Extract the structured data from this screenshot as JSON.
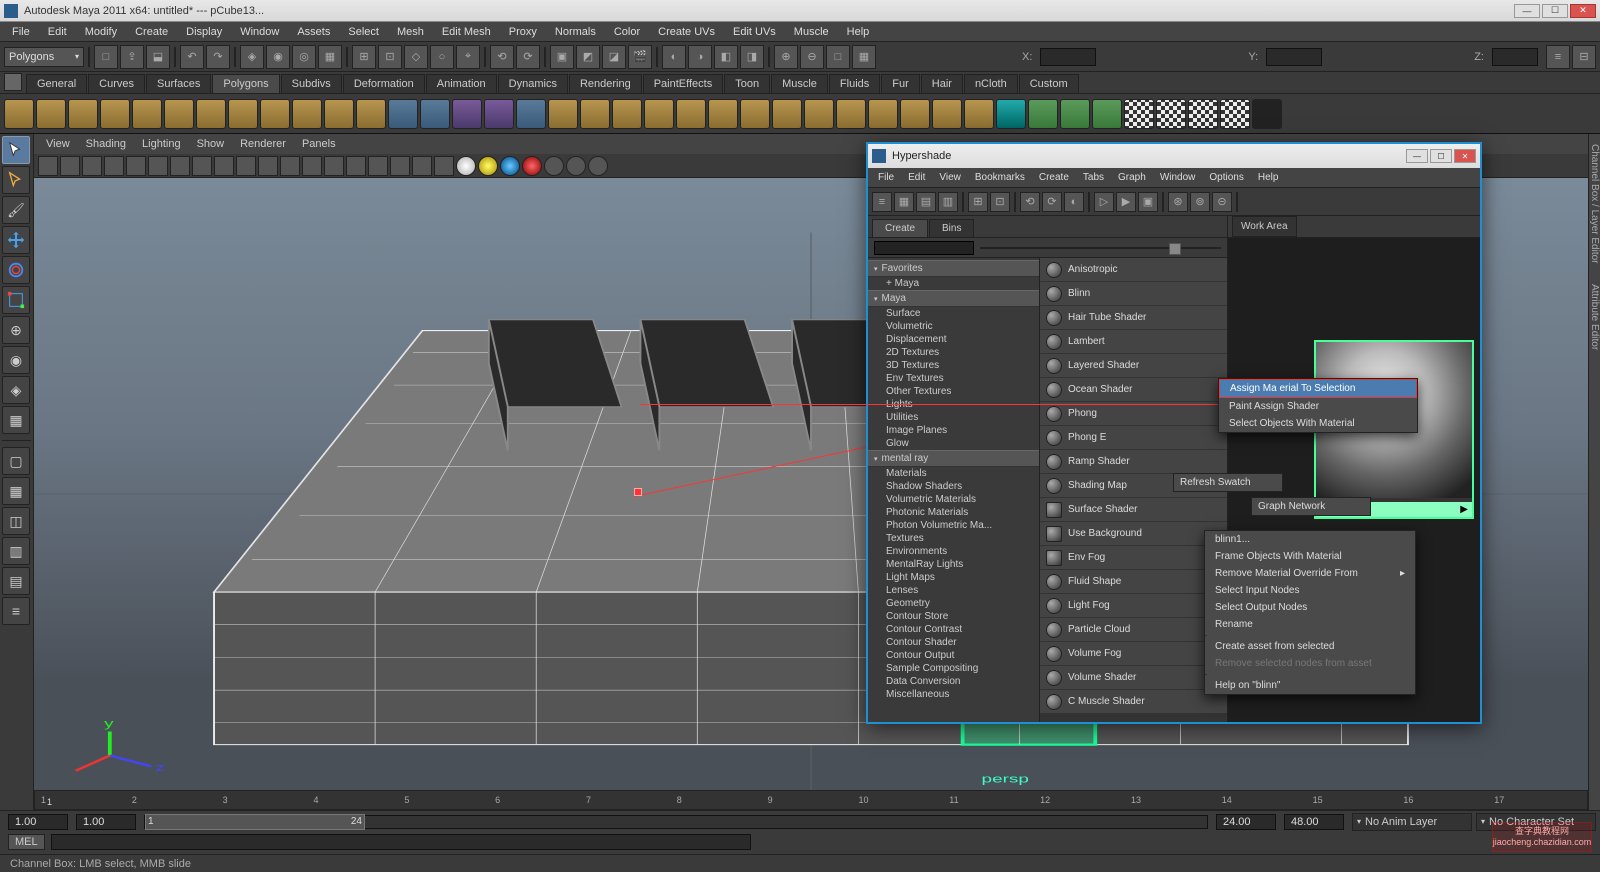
{
  "window": {
    "title": "Autodesk Maya 2011 x64: untitled*  ---   pCube13..."
  },
  "main_menu": [
    "File",
    "Edit",
    "Modify",
    "Create",
    "Display",
    "Window",
    "Assets",
    "Select",
    "Mesh",
    "Edit Mesh",
    "Proxy",
    "Normals",
    "Color",
    "Create UVs",
    "Edit UVs",
    "Muscle",
    "Help"
  ],
  "preset": "Polygons",
  "coords": {
    "x_label": "X:",
    "y_label": "Y:",
    "z_label": "Z:"
  },
  "shelf_tabs": [
    "General",
    "Curves",
    "Surfaces",
    "Polygons",
    "Subdivs",
    "Deformation",
    "Animation",
    "Dynamics",
    "Rendering",
    "PaintEffects",
    "Toon",
    "Muscle",
    "Fluids",
    "Fur",
    "Hair",
    "nCloth",
    "Custom"
  ],
  "shelf_active": "Polygons",
  "view_menu": [
    "View",
    "Shading",
    "Lighting",
    "Show",
    "Renderer",
    "Panels"
  ],
  "viewport_label": "persp",
  "right_sidebar": [
    "Channel Box / Layer Editor",
    "Attribute Editor"
  ],
  "timeline": {
    "ticks": [
      "1",
      "2",
      "3",
      "4",
      "5",
      "6",
      "7",
      "8",
      "9",
      "10",
      "11",
      "12",
      "13",
      "14",
      "15",
      "16",
      "17"
    ],
    "start": "1",
    "current": "1"
  },
  "range": {
    "in": "1.00",
    "in2": "1.00",
    "out": "24.00",
    "out2": "48.00",
    "noanim": "No Anim Layer",
    "nochar": "No Character Set"
  },
  "cmd": {
    "tag": "MEL"
  },
  "status": "Channel Box: LMB select, MMB slide",
  "hypershade": {
    "title": "Hypershade",
    "menu": [
      "File",
      "Edit",
      "View",
      "Bookmarks",
      "Create",
      "Tabs",
      "Graph",
      "Window",
      "Options",
      "Help"
    ],
    "tabs": [
      "Create",
      "Bins"
    ],
    "active_tab": "Create",
    "work_label": "Work Area",
    "tree": [
      {
        "type": "cat",
        "label": "Favorites"
      },
      {
        "type": "item",
        "label": "+ Maya"
      },
      {
        "type": "cat",
        "label": "Maya"
      },
      {
        "type": "item",
        "label": "Surface"
      },
      {
        "type": "item",
        "label": "Volumetric"
      },
      {
        "type": "item",
        "label": "Displacement"
      },
      {
        "type": "item",
        "label": "2D Textures"
      },
      {
        "type": "item",
        "label": "3D Textures"
      },
      {
        "type": "item",
        "label": "Env Textures"
      },
      {
        "type": "item",
        "label": "Other Textures"
      },
      {
        "type": "item",
        "label": "Lights"
      },
      {
        "type": "item",
        "label": "Utilities"
      },
      {
        "type": "item",
        "label": "Image Planes"
      },
      {
        "type": "item",
        "label": "Glow"
      },
      {
        "type": "cat",
        "label": "mental ray"
      },
      {
        "type": "item",
        "label": "Materials"
      },
      {
        "type": "item",
        "label": "Shadow Shaders"
      },
      {
        "type": "item",
        "label": "Volumetric Materials"
      },
      {
        "type": "item",
        "label": "Photonic Materials"
      },
      {
        "type": "item",
        "label": "Photon Volumetric Ma..."
      },
      {
        "type": "item",
        "label": "Textures"
      },
      {
        "type": "item",
        "label": "Environments"
      },
      {
        "type": "item",
        "label": "MentalRay Lights"
      },
      {
        "type": "item",
        "label": "Light Maps"
      },
      {
        "type": "item",
        "label": "Lenses"
      },
      {
        "type": "item",
        "label": "Geometry"
      },
      {
        "type": "item",
        "label": "Contour Store"
      },
      {
        "type": "item",
        "label": "Contour Contrast"
      },
      {
        "type": "item",
        "label": "Contour Shader"
      },
      {
        "type": "item",
        "label": "Contour Output"
      },
      {
        "type": "item",
        "label": "Sample Compositing"
      },
      {
        "type": "item",
        "label": "Data Conversion"
      },
      {
        "type": "item",
        "label": "Miscellaneous"
      }
    ],
    "shaders": [
      "Anisotropic",
      "Blinn",
      "Hair Tube Shader",
      "Lambert",
      "Layered Shader",
      "Ocean Shader",
      "Phong",
      "Phong E",
      "Ramp Shader",
      "Shading Map",
      "Surface Shader",
      "Use Background",
      "Env Fog",
      "Fluid Shape",
      "Light Fog",
      "Particle Cloud",
      "Volume Fog",
      "Volume Shader",
      "C Muscle Shader"
    ],
    "node_label": "blinn1"
  },
  "ctx_inner": [
    "Assign Ma  erial To Selection",
    "Paint Assign Shader",
    "Select Objects With Material",
    "Refresh Swatch",
    "Graph Network"
  ],
  "ctx_outer": [
    "blinn1...",
    "Frame Objects With Material",
    "Remove Material Override From",
    "Select Input Nodes",
    "Select Output Nodes",
    "Rename",
    "Create asset from selected",
    "Remove selected nodes from asset",
    "Help on \"blinn\""
  ],
  "watermark": "查字典教程网 jiaocheng.chazidian.com"
}
